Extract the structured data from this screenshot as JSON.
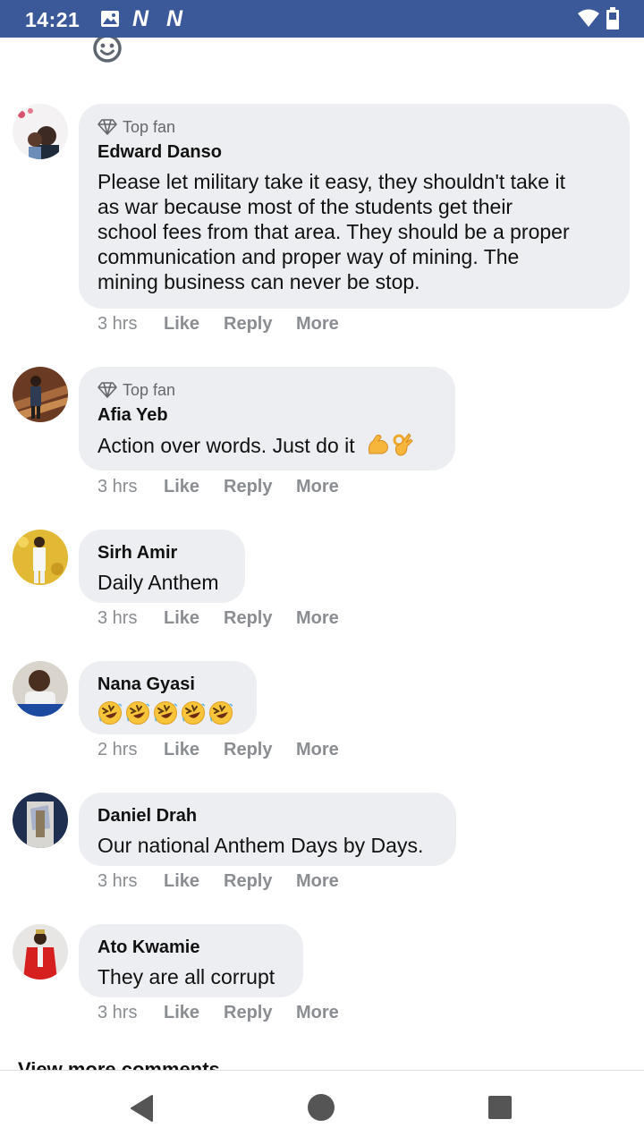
{
  "status_bar": {
    "time": "14:21",
    "color": "#3b5998"
  },
  "view_more": "View more comments",
  "comments": [
    {
      "top_fan": "Top fan",
      "name": "Edward Danso",
      "lines": [
        "Please let military take it easy, they shouldn't take it",
        "as war because most of the students get their",
        "school fees from that area. They should be a proper",
        "communication and proper way of mining. The",
        "mining business can never be stop."
      ],
      "time": "3 hrs",
      "like": "Like",
      "reply": "Reply",
      "more": "More"
    },
    {
      "top_fan": "Top fan",
      "name": "Afia Yeb",
      "lines": [
        "Action over words. Just do it"
      ],
      "emojis": [
        "flexed-biceps",
        "ok-hand"
      ],
      "time": "3 hrs",
      "like": "Like",
      "reply": "Reply",
      "more": "More"
    },
    {
      "name": "Sirh Amir",
      "lines": [
        "Daily Anthem"
      ],
      "time": "3 hrs",
      "like": "Like",
      "reply": "Reply",
      "more": "More"
    },
    {
      "name": "Nana Gyasi",
      "emojis": [
        "rolling-on-floor-laughing",
        "rolling-on-floor-laughing",
        "rolling-on-floor-laughing",
        "rolling-on-floor-laughing",
        "rolling-on-floor-laughing"
      ],
      "time": "2 hrs",
      "like": "Like",
      "reply": "Reply",
      "more": "More"
    },
    {
      "name": "Daniel Drah",
      "lines": [
        "Our national Anthem Days by Days."
      ],
      "time": "3 hrs",
      "like": "Like",
      "reply": "Reply",
      "more": "More"
    },
    {
      "name": "Ato Kwamie",
      "lines": [
        "They are all corrupt"
      ],
      "time": "3 hrs",
      "like": "Like",
      "reply": "Reply",
      "more": "More"
    }
  ]
}
